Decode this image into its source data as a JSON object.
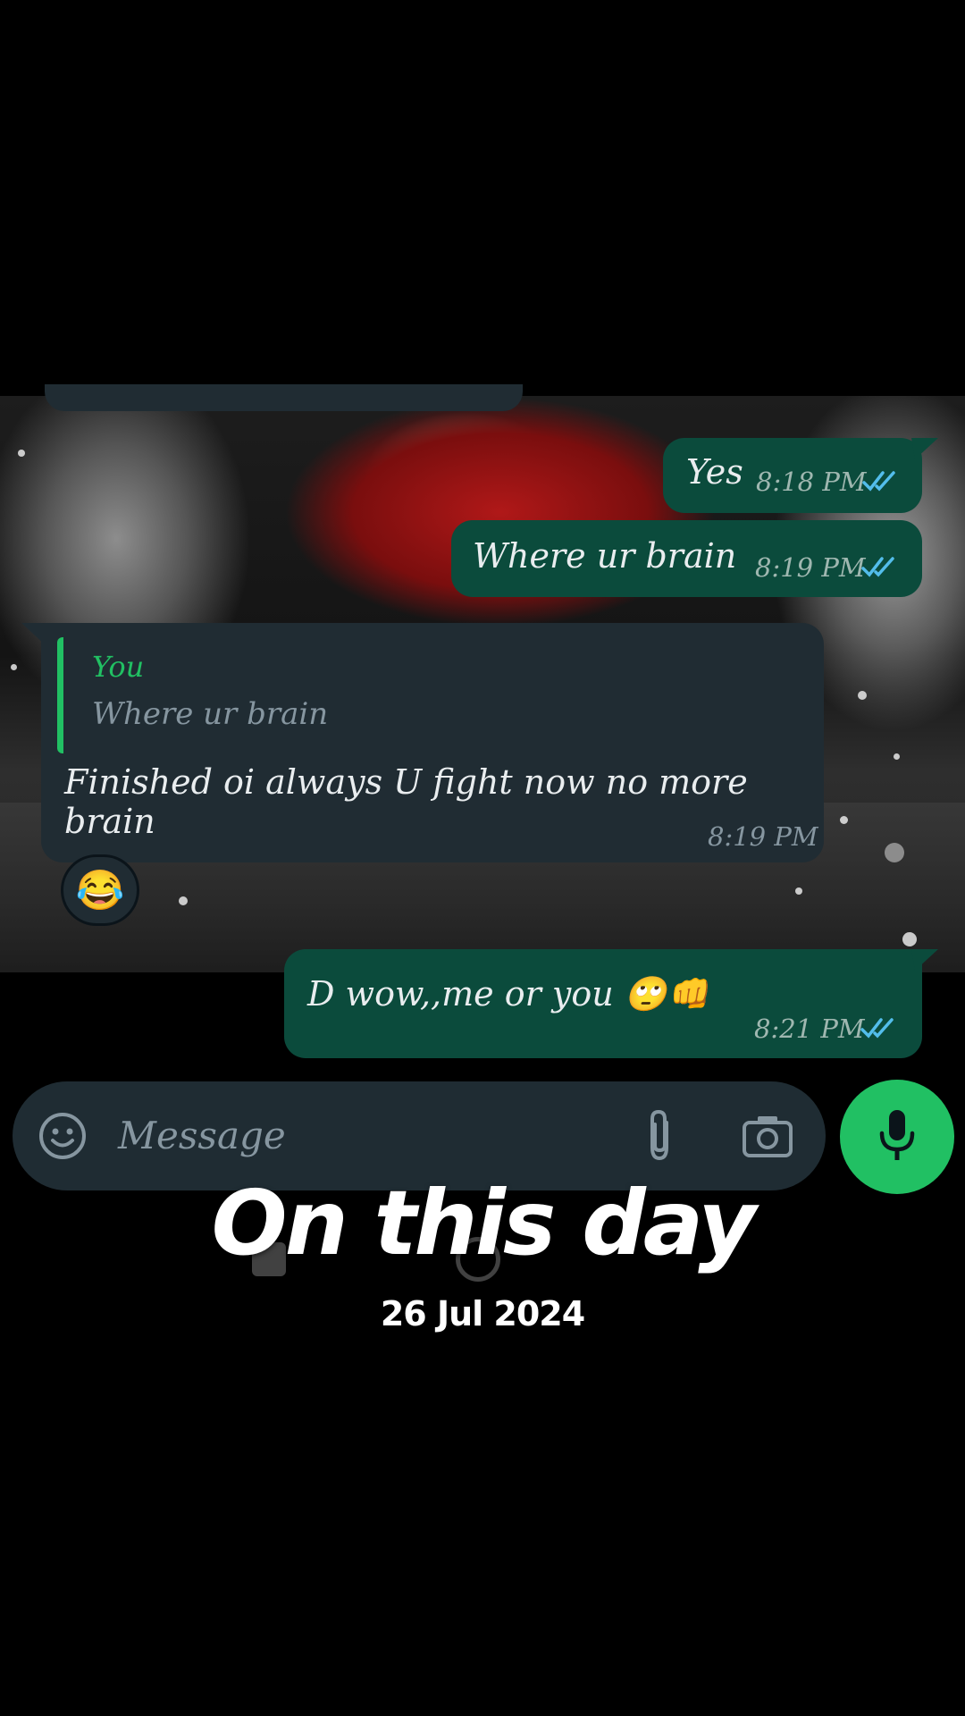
{
  "chat": {
    "messages": [
      {
        "direction": "outgoing",
        "text": "Yes",
        "time": "8:18 PM",
        "status": "read"
      },
      {
        "direction": "outgoing",
        "text": "Where ur brain",
        "time": "8:19 PM",
        "status": "read"
      },
      {
        "direction": "incoming",
        "reply": {
          "author": "You",
          "text": "Where ur brain"
        },
        "text_line1": "Finished oi always U fight now no more",
        "text_line2": "brain",
        "time": "8:19 PM",
        "reaction": "😂"
      },
      {
        "direction": "outgoing",
        "text": "D wow,,me or you 🙄👊",
        "time": "8:21 PM",
        "status": "read"
      }
    ]
  },
  "input": {
    "placeholder": "Message"
  },
  "icons": {
    "emoji": "smiley-icon",
    "attach": "paperclip-icon",
    "camera": "camera-icon",
    "mic": "microphone-icon",
    "ticks": "double-check-icon"
  },
  "colors": {
    "outgoing_bubble": "#0b4b3c",
    "incoming_bubble": "#202c33",
    "accent_green": "#21c063",
    "read_ticks": "#53bdeb"
  },
  "overlay": {
    "title": "On this day",
    "date": "26 Jul 2024"
  }
}
